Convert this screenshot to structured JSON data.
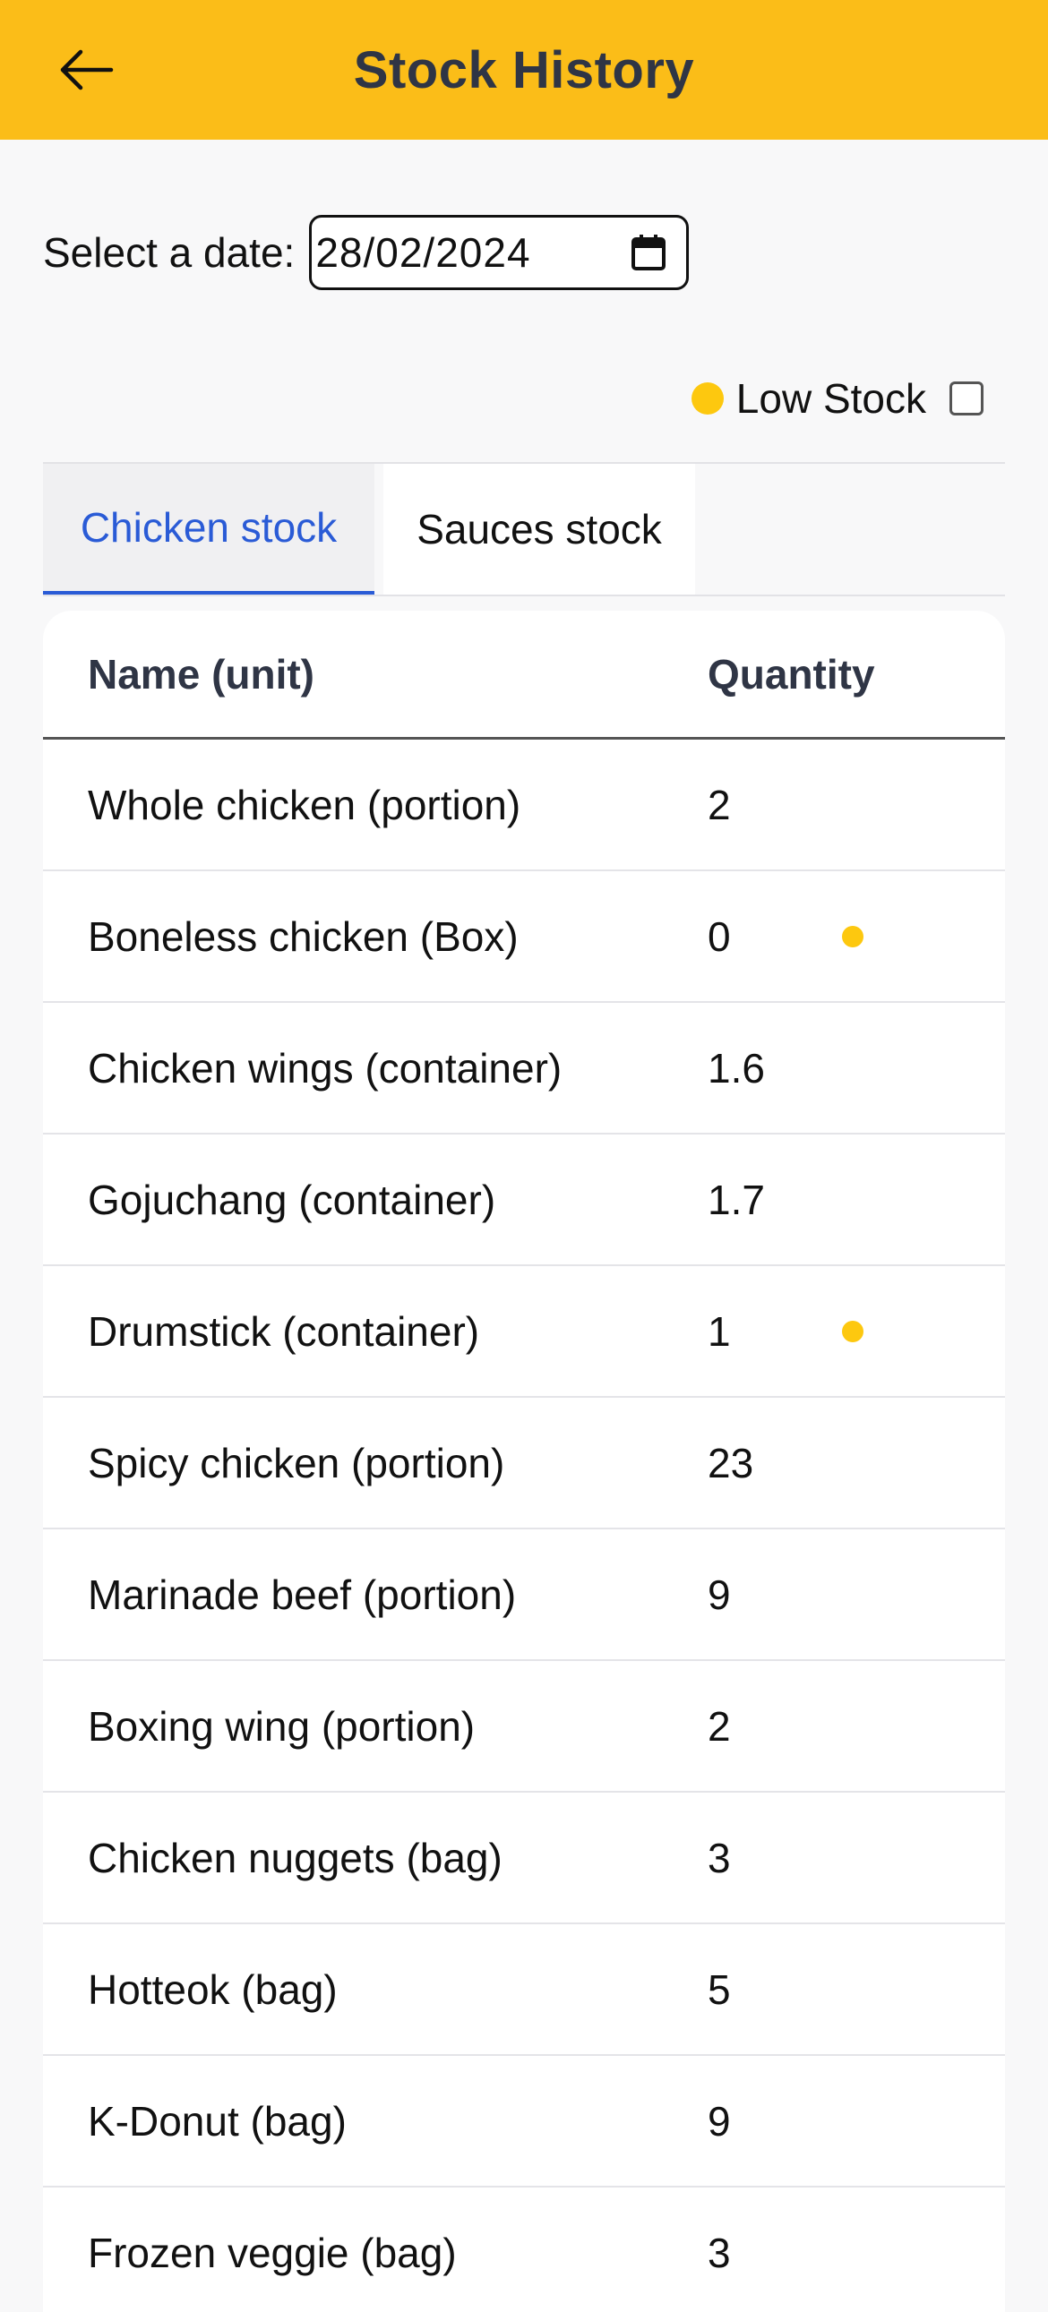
{
  "header": {
    "title": "Stock History",
    "back_icon": "arrow-left-icon",
    "background_color": "#fbbd18"
  },
  "date_filter": {
    "label": "Select a date:",
    "value": "28/02/2024",
    "icon": "calendar-icon"
  },
  "legend": {
    "label": "Low Stock",
    "dot_color": "#fdc80f",
    "checkbox_checked": false
  },
  "tabs": [
    {
      "label": "Chicken stock",
      "active": true
    },
    {
      "label": "Sauces stock",
      "active": false
    }
  ],
  "table": {
    "columns": [
      "Name (unit)",
      "Quantity"
    ],
    "rows": [
      {
        "name": "Whole chicken (portion)",
        "quantity": "2",
        "low_stock": false
      },
      {
        "name": "Boneless chicken (Box)",
        "quantity": "0",
        "low_stock": true
      },
      {
        "name": "Chicken wings (container)",
        "quantity": "1.6",
        "low_stock": false
      },
      {
        "name": "Gojuchang (container)",
        "quantity": "1.7",
        "low_stock": false
      },
      {
        "name": "Drumstick (container)",
        "quantity": "1",
        "low_stock": true
      },
      {
        "name": "Spicy chicken (portion)",
        "quantity": "23",
        "low_stock": false
      },
      {
        "name": "Marinade beef (portion)",
        "quantity": "9",
        "low_stock": false
      },
      {
        "name": "Boxing wing (portion)",
        "quantity": "2",
        "low_stock": false
      },
      {
        "name": "Chicken nuggets (bag)",
        "quantity": "3",
        "low_stock": false
      },
      {
        "name": "Hotteok (bag)",
        "quantity": "5",
        "low_stock": false
      },
      {
        "name": "K-Donut (bag)",
        "quantity": "9",
        "low_stock": false
      },
      {
        "name": "Frozen veggie (bag)",
        "quantity": "3",
        "low_stock": false
      }
    ]
  }
}
